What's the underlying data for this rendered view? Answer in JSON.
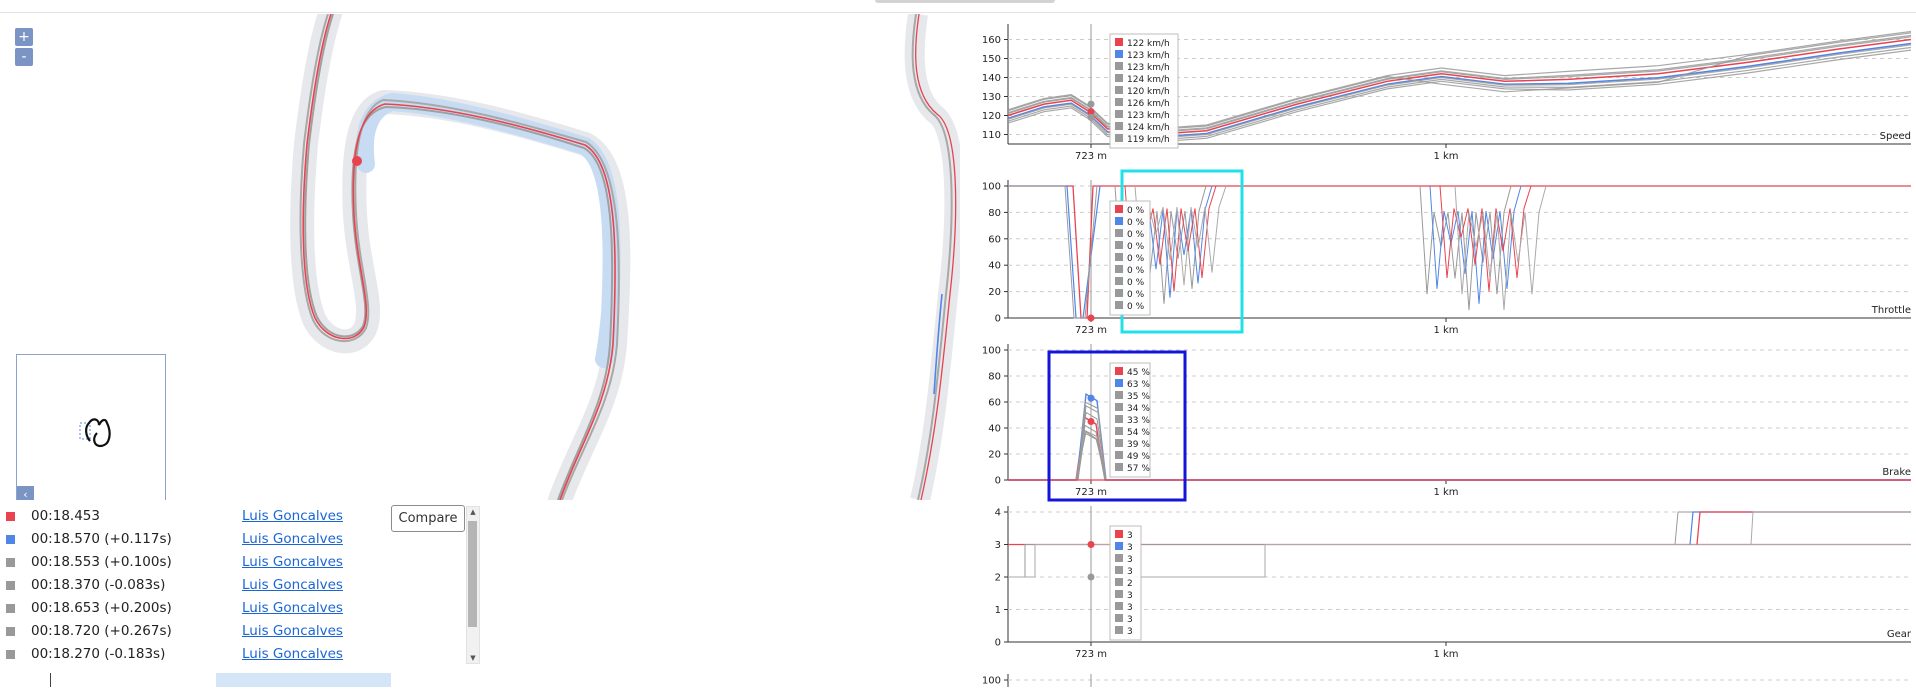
{
  "map": {
    "zoom_in_label": "+",
    "zoom_out_label": "-",
    "minimap_toggle_label": "‹"
  },
  "laps": {
    "compare_label": "Compare",
    "rows": [
      {
        "time": "00:18.453",
        "driver": "Luis Goncalves",
        "color": "#e8434f"
      },
      {
        "time": "00:18.570 (+0.117s)",
        "driver": "Luis Goncalves",
        "color": "#4f86e8"
      },
      {
        "time": "00:18.553 (+0.100s)",
        "driver": "Luis Goncalves",
        "color": "#999999"
      },
      {
        "time": "00:18.370 (-0.083s)",
        "driver": "Luis Goncalves",
        "color": "#999999"
      },
      {
        "time": "00:18.653 (+0.200s)",
        "driver": "Luis Goncalves",
        "color": "#999999"
      },
      {
        "time": "00:18.720 (+0.267s)",
        "driver": "Luis Goncalves",
        "color": "#999999"
      },
      {
        "time": "00:18.270 (-0.183s)",
        "driver": "Luis Goncalves",
        "color": "#999999"
      }
    ]
  },
  "colors": {
    "red": "#e8434f",
    "blue": "#4f86e8",
    "grey": "#9e9e9e",
    "cyan_box": "#22e0e8",
    "blue_box": "#1515d8"
  },
  "chart_data": [
    {
      "type": "line",
      "title": "Speed",
      "ylim": [
        105,
        165
      ],
      "yticks": [
        110,
        120,
        130,
        140,
        150,
        160
      ],
      "xticks": [
        "723 m",
        "1 km"
      ],
      "tooltip": [
        "122 km/h",
        "123 km/h",
        "123 km/h",
        "124 km/h",
        "120 km/h",
        "126 km/h",
        "123 km/h",
        "124 km/h",
        "119 km/h"
      ]
    },
    {
      "type": "line",
      "title": "Throttle",
      "ylim": [
        0,
        100
      ],
      "yticks": [
        0,
        20,
        40,
        60,
        80,
        100
      ],
      "xticks": [
        "723 m",
        "1 km"
      ],
      "tooltip": [
        "0 %",
        "0 %",
        "0 %",
        "0 %",
        "0 %",
        "0 %",
        "0 %",
        "0 %",
        "0 %"
      ]
    },
    {
      "type": "line",
      "title": "Brake",
      "ylim": [
        0,
        100
      ],
      "yticks": [
        0,
        20,
        40,
        60,
        80,
        100
      ],
      "xticks": [
        "723 m",
        "1 km"
      ],
      "tooltip": [
        "45 %",
        "63 %",
        "35 %",
        "34 %",
        "33 %",
        "54 %",
        "39 %",
        "49 %",
        "57 %"
      ]
    },
    {
      "type": "line",
      "title": "Gear",
      "ylim": [
        0,
        4
      ],
      "yticks": [
        0,
        1,
        2,
        3,
        4
      ],
      "xticks": [
        "723 m",
        "1 km"
      ],
      "tooltip": [
        "3",
        "3",
        "3",
        "3",
        "2",
        "3",
        "3",
        "3",
        "3"
      ]
    },
    {
      "type": "line",
      "title": "",
      "ylim": [
        0,
        100
      ],
      "yticks": [
        100
      ],
      "xticks": []
    }
  ]
}
